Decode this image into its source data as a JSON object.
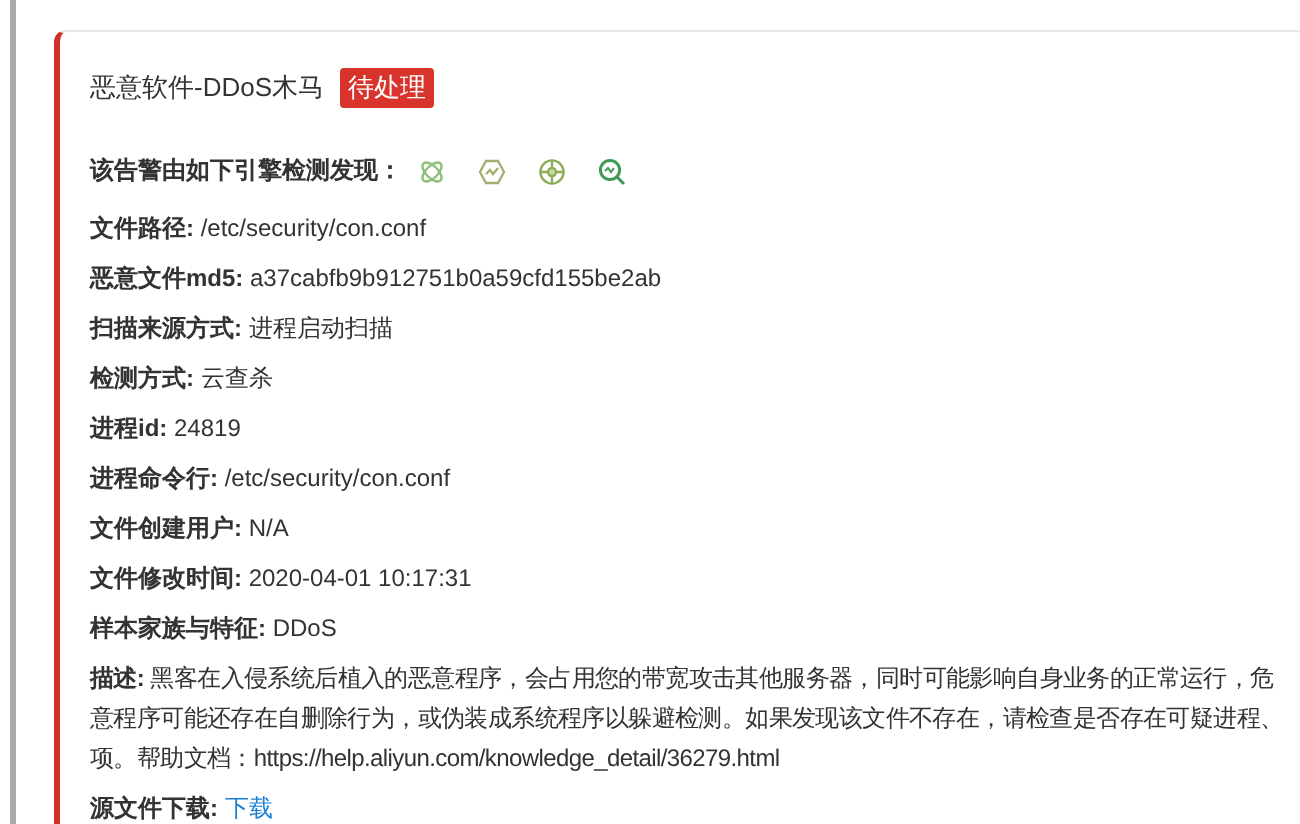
{
  "alert": {
    "title": "恶意软件-DDoS木马",
    "status": "待处理",
    "engines_label": "该告警由如下引擎检测发现：",
    "fields": [
      {
        "label": "文件路径:",
        "value": "/etc/security/con.conf"
      },
      {
        "label": "恶意文件md5:",
        "value": "a37cabfb9b912751b0a59cfd155be2ab"
      },
      {
        "label": "扫描来源方式:",
        "value": "进程启动扫描"
      },
      {
        "label": "检测方式:",
        "value": "云查杀"
      },
      {
        "label": "进程id:",
        "value": "24819"
      },
      {
        "label": "进程命令行:",
        "value": "/etc/security/con.conf"
      },
      {
        "label": "文件创建用户:",
        "value": "N/A"
      },
      {
        "label": "文件修改时间:",
        "value": "2020-04-01 10:17:31"
      },
      {
        "label": "样本家族与特征:",
        "value": "DDoS"
      }
    ],
    "description": {
      "label": "描述:",
      "lines": [
        "黑客在入侵系统后植入的恶意程序，会占用您的带宽攻击其他服务器，同时可能影响自身业务的正常运行，危",
        "意程序可能还存在自删除行为，或伪装成系统程序以躲避检测。如果发现该文件不存在，请检查是否存在可疑进程、",
        "项。帮助文档：https://help.aliyun.com/knowledge_detail/36279.html"
      ]
    },
    "download": {
      "label": "源文件下载:",
      "link": "下载"
    }
  }
}
